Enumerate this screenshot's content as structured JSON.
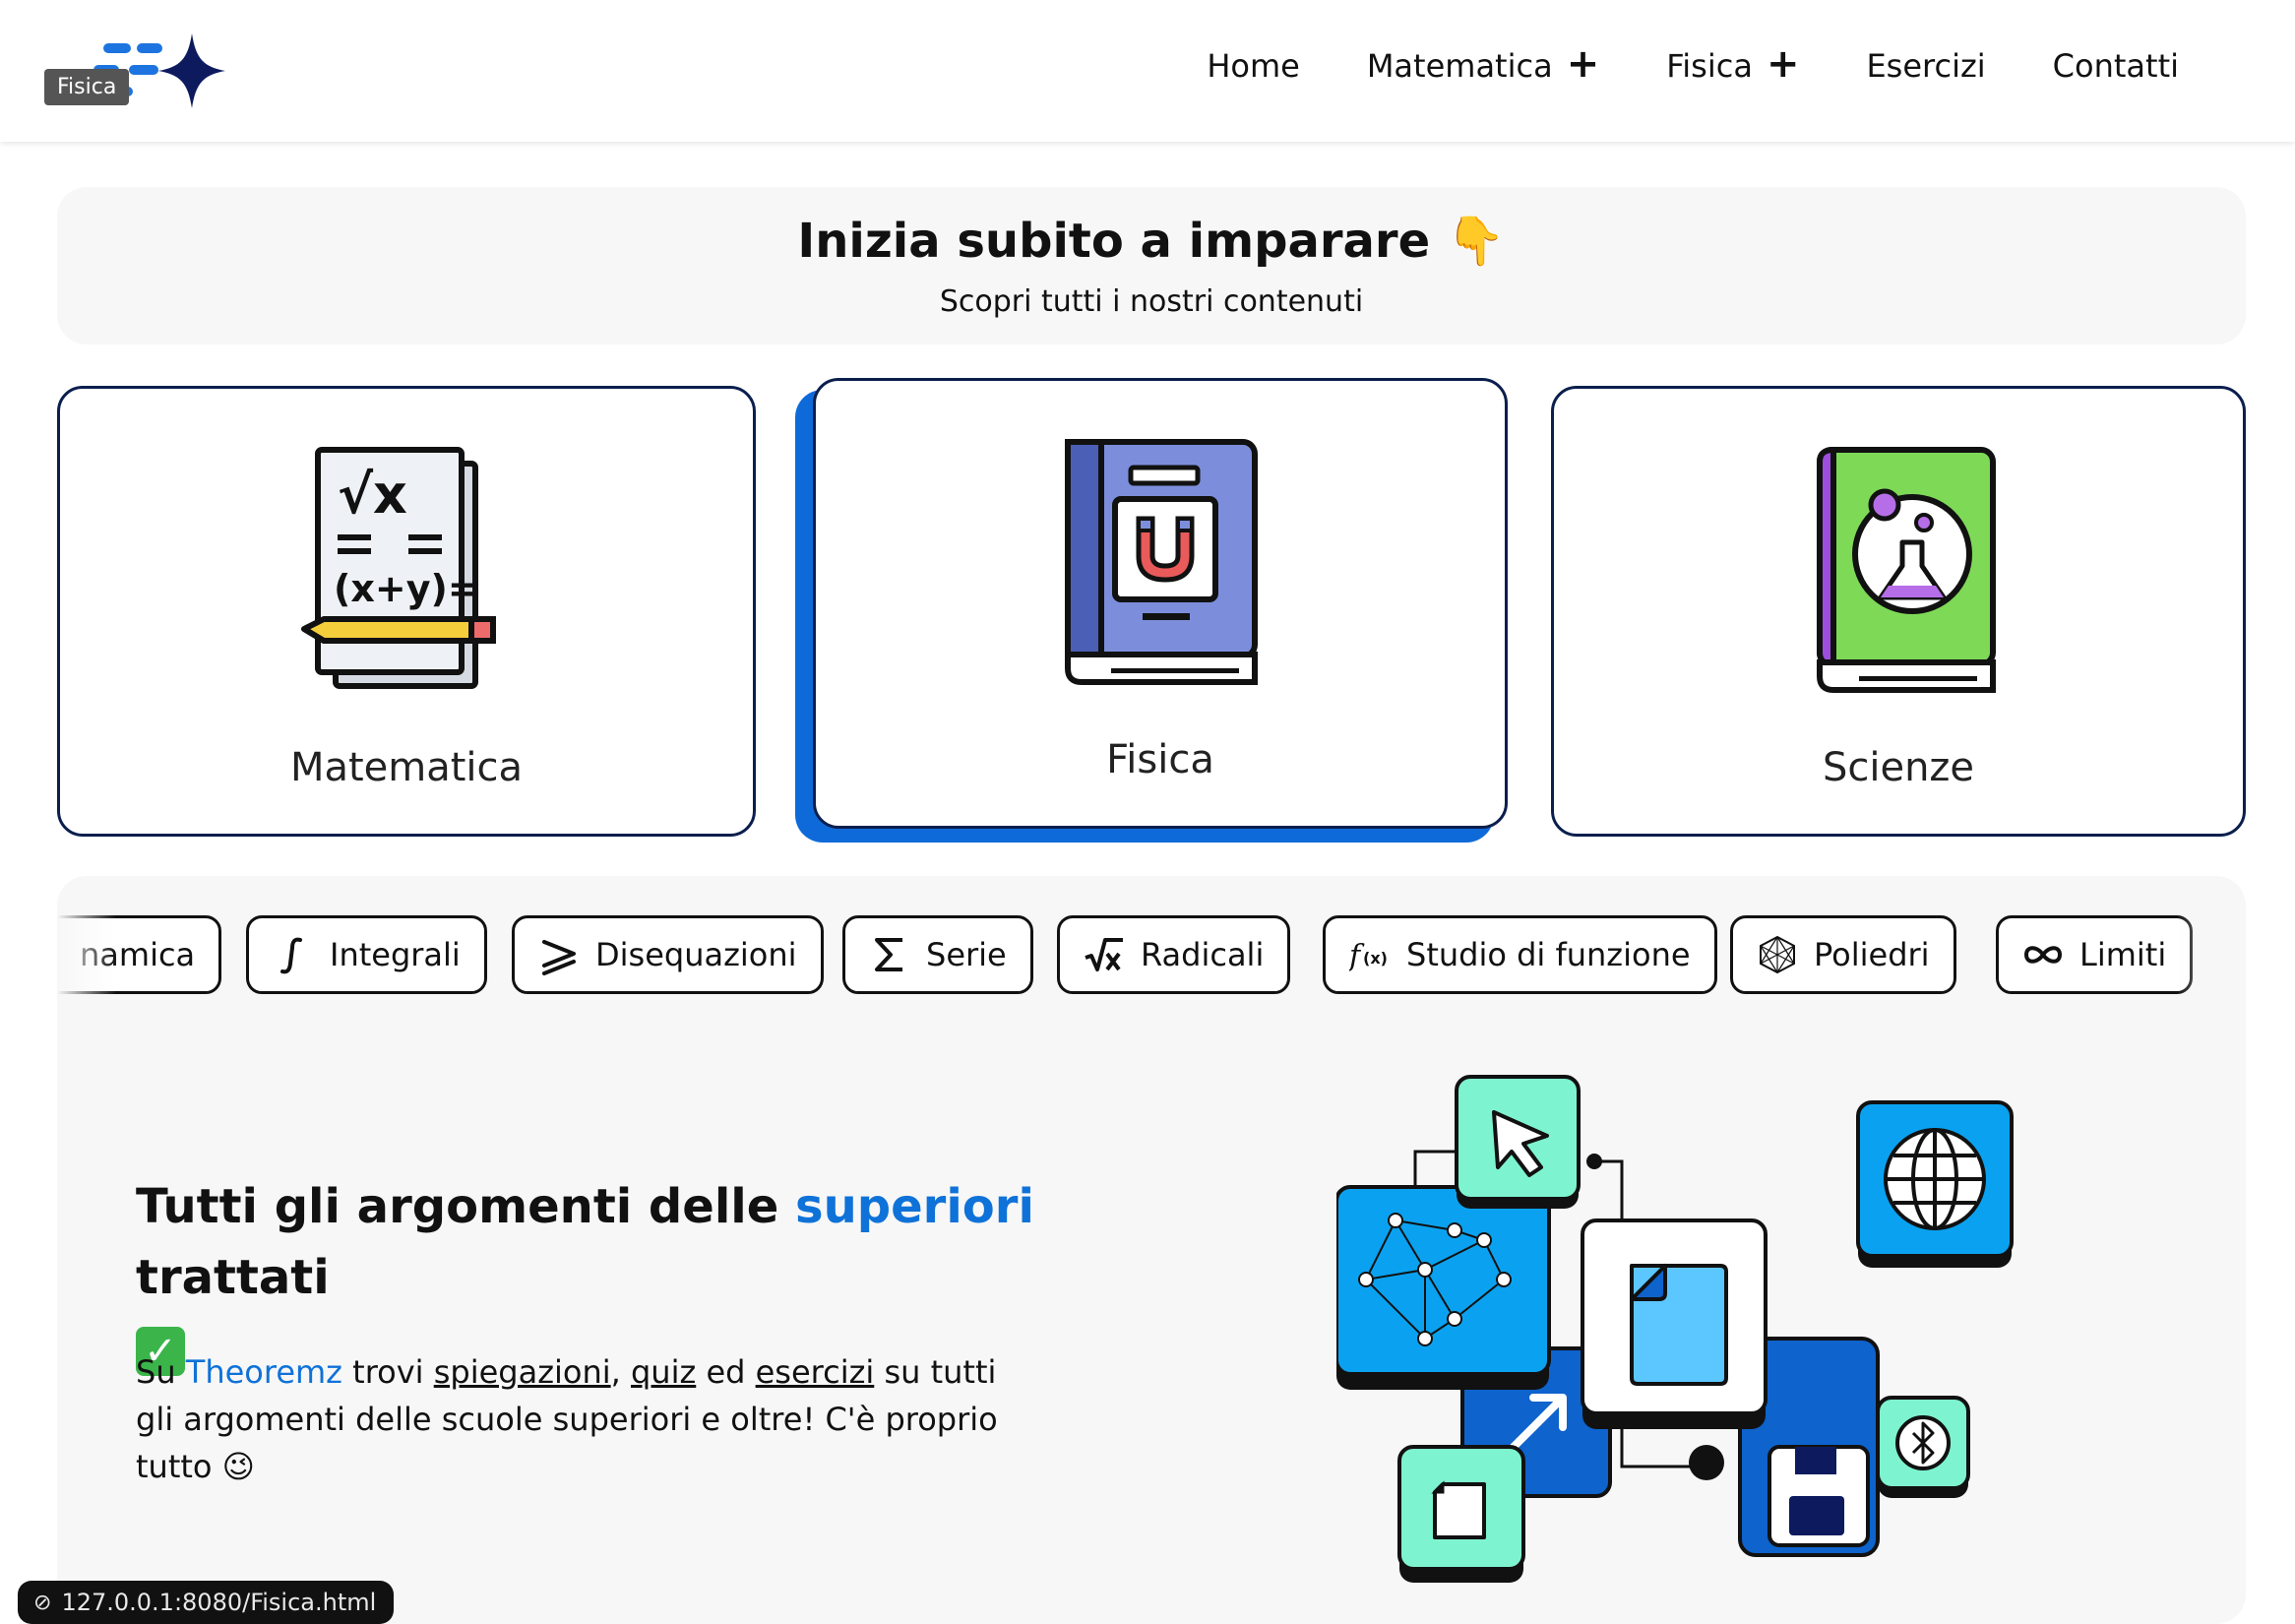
{
  "logo": {
    "tooltip": "Fisica"
  },
  "nav": [
    {
      "label": "Home",
      "expand": false
    },
    {
      "label": "Matematica",
      "expand": true
    },
    {
      "label": "Fisica",
      "expand": true
    },
    {
      "label": "Esercizi",
      "expand": false
    },
    {
      "label": "Contatti",
      "expand": false
    }
  ],
  "hero": {
    "title": "Inizia subito a imparare",
    "emoji": "👇",
    "subtitle": "Scopri tutti i nostri contenuti"
  },
  "cards": [
    {
      "label": "Matematica",
      "icon": "math-book-icon"
    },
    {
      "label": "Fisica",
      "icon": "physics-book-icon"
    },
    {
      "label": "Scienze",
      "icon": "science-book-icon"
    }
  ],
  "chips": [
    {
      "label": "namica",
      "icon": "none"
    },
    {
      "label": "Integrali",
      "icon": "integral-icon"
    },
    {
      "label": "Disequazioni",
      "icon": "inequality-icon"
    },
    {
      "label": "Serie",
      "icon": "sigma-icon"
    },
    {
      "label": "Radicali",
      "icon": "sqrt-icon"
    },
    {
      "label": "Studio di funzione",
      "icon": "function-icon"
    },
    {
      "label": "Poliedri",
      "icon": "polyhedron-icon"
    },
    {
      "label": "Limiti",
      "icon": "infinity-icon"
    }
  ],
  "section": {
    "title_pre": "Tutti gli argomenti delle ",
    "title_highlight": "superiori",
    "title_post": " trattati",
    "text_su": "Su ",
    "brand": "Theoremz",
    "text_trovi": " trovi ",
    "link_spiegazioni": "spiegazioni",
    "comma": ", ",
    "link_quiz": "quiz",
    "text_ed": " ed ",
    "link_esercizi": "esercizi",
    "text_rest": " su tutti gli argomenti delle scuole superiori e oltre! C'è proprio tutto ",
    "emoji_wink": "😉"
  },
  "status_bar": {
    "url": "127.0.0.1:8080/Fisica.html"
  },
  "colors": {
    "accent": "#0f72d8",
    "card_border": "#0b1f4d",
    "panel": "#f7f7f7"
  }
}
